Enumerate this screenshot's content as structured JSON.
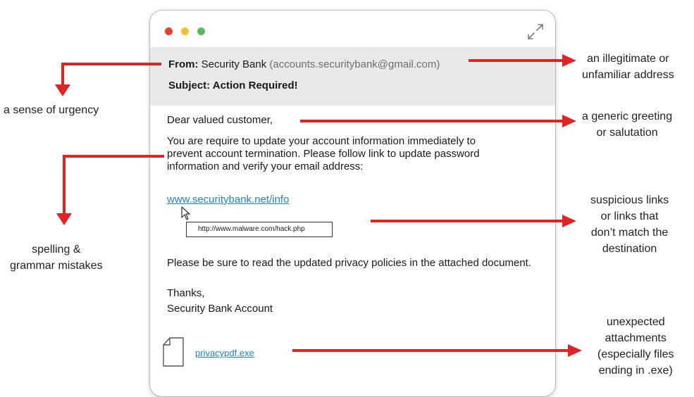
{
  "colors": {
    "dot_red": "#e8412c",
    "dot_yellow": "#f2c230",
    "dot_green": "#5cb85c",
    "arrow": "#e02424",
    "link": "#1e84c9",
    "header_bg": "#e9e9e9"
  },
  "email": {
    "from_label": "From:",
    "from_name": "Security Bank",
    "from_address": "(accounts.securitybank@gmail.com)",
    "subject": "Subject: Action Required!",
    "greeting": "Dear valued customer,",
    "paragraph": [
      "You are require to update your account information immediately to",
      "prevent account termination. Please follow link to update password",
      "information and verify your email address:"
    ],
    "link_text": "www.securitybank.net/info",
    "tooltip_url": "http://www.malware.com/hack.php",
    "privacy_note": "Please be sure to read the updated privacy policies in the attached document.",
    "signoff": "Thanks,",
    "signature": "Security Bank Account",
    "attachment_name": "privacypdf.exe"
  },
  "icons": {
    "window_controls": [
      "close-dot",
      "minimize-dot",
      "zoom-dot"
    ],
    "expand": "expand-arrows-icon",
    "cursor": "mouse-pointer-icon",
    "attachment": "document-file-icon"
  },
  "annotations": {
    "urgency": [
      "a sense of urgency"
    ],
    "illegitimate_address": [
      "an illegitimate or",
      "unfamiliar address"
    ],
    "generic_greeting": [
      "a generic greeting",
      "or salutation"
    ],
    "spelling": [
      "spelling &",
      "grammar mistakes"
    ],
    "suspicious_links": [
      "suspicious links",
      "or links that",
      "don’t match the",
      "destination"
    ],
    "attachments": [
      "unexpected",
      "attachments",
      "(especially files",
      "ending in .exe)"
    ]
  }
}
